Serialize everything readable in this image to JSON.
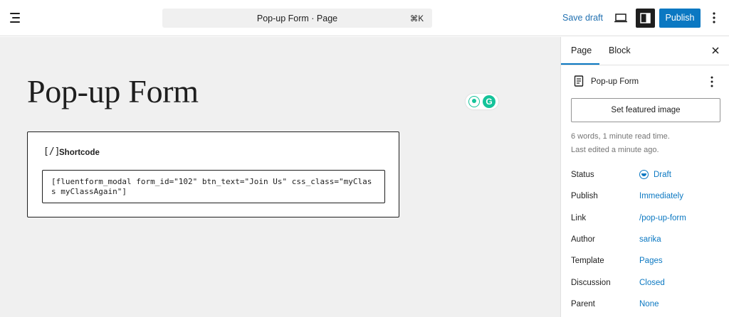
{
  "topbar": {
    "document_title": "Pop-up Form · Page",
    "shortcut": "⌘K",
    "save_draft_label": "Save draft",
    "publish_label": "Publish"
  },
  "editor": {
    "title": "Pop-up Form",
    "shortcode_block": {
      "icon": "[/]",
      "label": "Shortcode",
      "value": "[fluentform_modal form_id=\"102\" btn_text=\"Join Us\" css_class=\"myClass myClassAgain\"]"
    }
  },
  "sidebar": {
    "tabs": [
      {
        "label": "Page",
        "active": true
      },
      {
        "label": "Block",
        "active": false
      }
    ],
    "document": {
      "title": "Pop-up Form"
    },
    "featured_image_label": "Set featured image",
    "reading_info": "6 words, 1 minute read time.",
    "last_edited": "Last edited a minute ago.",
    "properties": [
      {
        "label": "Status",
        "value": "Draft"
      },
      {
        "label": "Publish",
        "value": "Immediately"
      },
      {
        "label": "Link",
        "value": "/pop-up-form"
      },
      {
        "label": "Author",
        "value": "sarika"
      },
      {
        "label": "Template",
        "value": "Pages"
      },
      {
        "label": "Discussion",
        "value": "Closed"
      },
      {
        "label": "Parent",
        "value": "None"
      }
    ]
  },
  "colors": {
    "accent": "#0b78c2",
    "canvas_bg": "#f0f0f0",
    "grammarly": "#15c39a"
  }
}
